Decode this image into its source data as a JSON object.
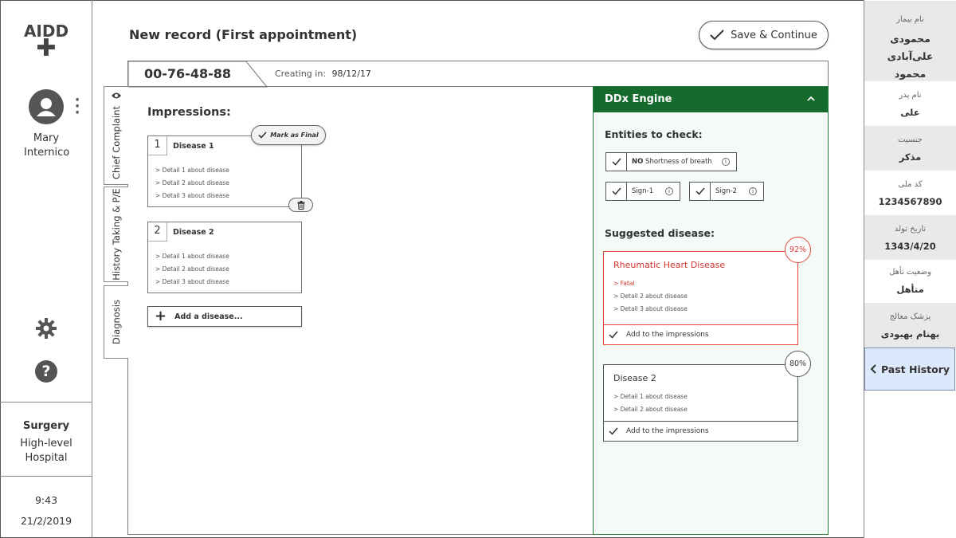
{
  "app": {
    "logo_text": "AIDD",
    "logo_plus": "✚"
  },
  "user": {
    "name": "Mary Internico"
  },
  "facility": {
    "department": "Surgery",
    "hospital": "High-level Hospital"
  },
  "clock": {
    "time": "9:43",
    "date": "21/2/2019"
  },
  "header": {
    "page_title": "New record (First appointment)",
    "save_label": "Save & Continue"
  },
  "record": {
    "id": "00-76-48-88",
    "creating_label": "Creating in:",
    "creating_date": "98/12/17"
  },
  "vertical_tabs": [
    {
      "label": "Chief Complaint"
    },
    {
      "label": "History Taking & P/E"
    },
    {
      "label": "Diagnosis"
    }
  ],
  "impressions": {
    "title": "Impressions:",
    "mark_final_label": "Mark as Final",
    "add_label": "Add a disease...",
    "items": [
      {
        "num": "1",
        "name": "Disease 1",
        "details": [
          "> Detail 1 about disease",
          "> Detail 2 about disease",
          "> Detail 3 about disease"
        ]
      },
      {
        "num": "2",
        "name": "Disease 2",
        "details": [
          "> Detail 1 about disease",
          "> Detail 2 about disease",
          "> Detail 3 about disease"
        ]
      }
    ]
  },
  "ddx": {
    "title": "DDx Engine",
    "entities_title": "Entities to check:",
    "entities": [
      {
        "prefix": "NO",
        "label": "Shortness of breath"
      },
      {
        "prefix": "",
        "label": "Sign-1"
      },
      {
        "prefix": "",
        "label": "Sign-2"
      }
    ],
    "suggested_title": "Suggested disease:",
    "suggestions": [
      {
        "name": "Rheumatic Heart Disease",
        "percent": "92%",
        "details": [
          "> Fatal",
          "> Detail 2 about disease",
          "> Detail 3 about disease"
        ],
        "add_label": "Add to the impressions"
      },
      {
        "name": "Disease 2",
        "percent": "80%",
        "details": [
          "> Detail 1 about disease",
          "> Detail 2 about disease"
        ],
        "add_label": "Add to the impressions"
      }
    ],
    "colors": {
      "header": "#156a2e",
      "alert": "#d2322d"
    }
  },
  "patient": {
    "name_label": "نام بیمار",
    "name_value": "محمودی علی‌آبادی محمود",
    "father_label": "نام پدر",
    "father_value": "علی",
    "gender_label": "جنسیت",
    "gender_value": "مذکر",
    "national_id_label": "کد ملی",
    "national_id_value": "1234567890",
    "birthdate_label": "تاریخ تولد",
    "birthdate_value": "1343/4/20",
    "marital_label": "وضعیت تأهل",
    "marital_value": "متأهل",
    "doctor_label": "پزشک معالج",
    "doctor_value": "بهنام بهبودی",
    "past_history_label": "Past History"
  }
}
